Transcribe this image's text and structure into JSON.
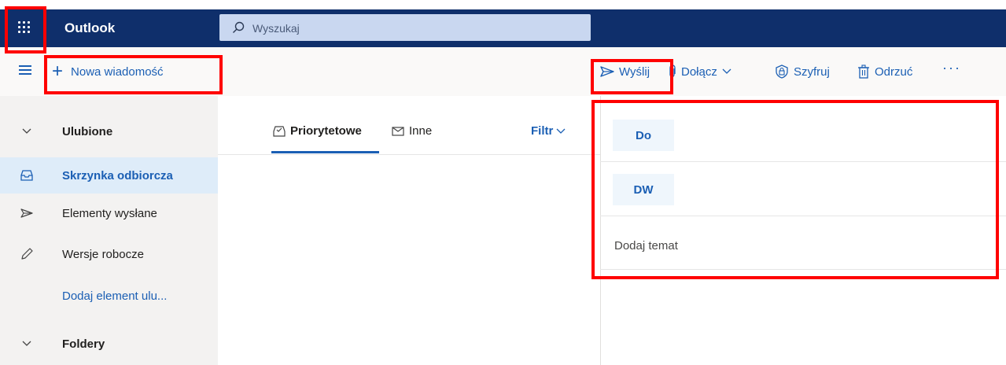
{
  "header": {
    "app_title": "Outlook",
    "search_placeholder": "Wyszukaj"
  },
  "commandbar": {
    "new_message": "Nowa wiadomość",
    "send": "Wyślij",
    "attach": "Dołącz",
    "encrypt": "Szyfruj",
    "discard": "Odrzuć",
    "more": "···"
  },
  "sidebar": {
    "favorites_label": "Ulubione",
    "items": [
      {
        "label": "Skrzynka odbiorcza",
        "icon": "inbox-icon",
        "selected": true
      },
      {
        "label": "Elementy wysłane",
        "icon": "send-icon",
        "selected": false
      },
      {
        "label": "Wersje robocze",
        "icon": "pencil-icon",
        "selected": false
      }
    ],
    "add_favorite": "Dodaj element ulu...",
    "folders_label": "Foldery"
  },
  "message_list": {
    "tabs": [
      {
        "label": "Priorytetowe",
        "active": true
      },
      {
        "label": "Inne",
        "active": false
      }
    ],
    "filter_label": "Filtr"
  },
  "compose": {
    "to_label": "Do",
    "cc_label": "DW",
    "subject_placeholder": "Dodaj temat"
  },
  "colors": {
    "topbar": "#0f2f6b",
    "accent": "#1b5fb4",
    "highlight": "#ff0000",
    "nav_background": "#f3f2f1",
    "nav_selected": "#deecf9"
  }
}
